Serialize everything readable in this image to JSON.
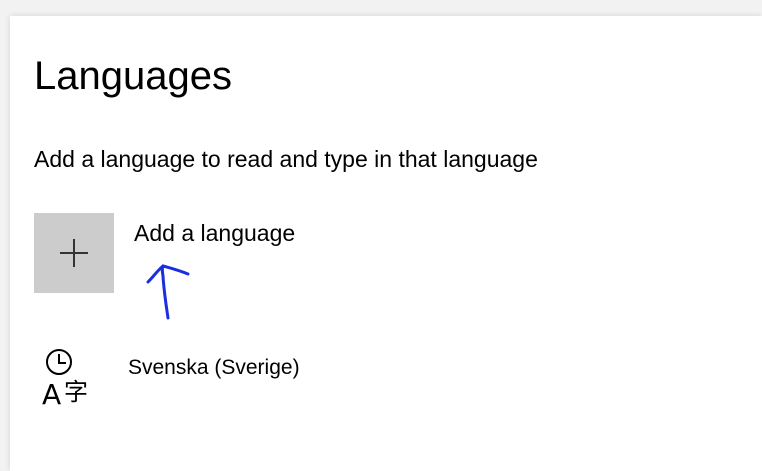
{
  "page": {
    "title": "Languages",
    "subtitle": "Add a language to read and type in that language"
  },
  "add_language": {
    "icon": "plus-icon",
    "label": "Add a language"
  },
  "installed_languages": [
    {
      "icon": "language-clock-icon",
      "label": "Svenska (Sverige)"
    }
  ],
  "annotation": {
    "icon": "hand-drawn-arrow-icon",
    "color": "#1a2fe0"
  },
  "colors": {
    "tile_background": "#cccccc",
    "panel_background": "#ffffff"
  }
}
